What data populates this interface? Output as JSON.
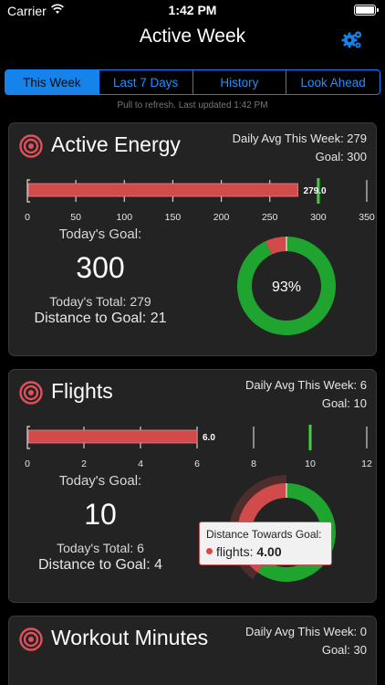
{
  "status_bar": {
    "carrier": "Carrier",
    "time": "1:42 PM"
  },
  "nav": {
    "title": "Active Week",
    "settings_icon": "gear-icon"
  },
  "segments": [
    "This Week",
    "Last 7 Days",
    "History",
    "Look Ahead"
  ],
  "refresh_text": "Pull to refresh.  Last updated 1:42 PM",
  "colors": {
    "accent": "#0a84ff",
    "bar": "#d24b4b",
    "goal_marker": "#2ed12e",
    "ring_progress": "#1fa52f",
    "ring_remaining": "#d24b4b"
  },
  "cards": [
    {
      "title": "Active Energy",
      "daily_avg_label": "Daily Avg This Week: 279",
      "goal_label": "Goal: 300",
      "todays_goal_label": "Today's Goal:",
      "goal_value": "300",
      "todays_total": "Today's Total: 279",
      "distance": "Distance to Goal: 21",
      "donut_label": "93%",
      "chart_data": {
        "type": "bar",
        "orientation": "horizontal",
        "value": 279,
        "value_label": "279.0",
        "goal": 300,
        "xlim": [
          0,
          350
        ],
        "ticks": [
          0,
          50,
          100,
          150,
          200,
          250,
          300,
          350
        ]
      },
      "donut": {
        "progress_fraction": 0.93
      }
    },
    {
      "title": "Flights",
      "daily_avg_label": "Daily Avg This Week: 6",
      "goal_label": "Goal: 10",
      "todays_goal_label": "Today's Goal:",
      "goal_value": "10",
      "todays_total": "Today's Total: 6",
      "distance": "Distance to Goal: 4",
      "donut_label": "",
      "chart_data": {
        "type": "bar",
        "orientation": "horizontal",
        "value": 6,
        "value_label": "6.0",
        "goal": 10,
        "xlim": [
          0,
          12
        ],
        "ticks": [
          0,
          2,
          4,
          6,
          8,
          10,
          12
        ]
      },
      "donut": {
        "progress_fraction": 0.6,
        "highlight": "remaining"
      }
    },
    {
      "title": "Workout Minutes",
      "daily_avg_label": "Daily Avg This Week: 0",
      "goal_label": "Goal: 30"
    }
  ],
  "tooltip": {
    "title": "Distance Towards Goal:",
    "series": "flights:",
    "value": "4.00"
  }
}
